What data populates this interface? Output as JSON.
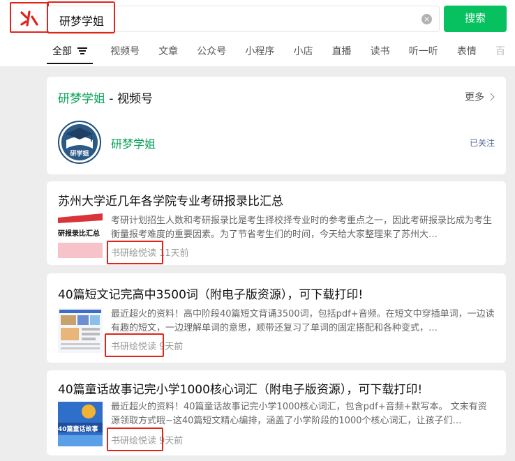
{
  "search": {
    "query": "研梦学姐",
    "button_label": "搜索",
    "clear_symbol": "×"
  },
  "tabs": [
    {
      "label": "全部"
    },
    {
      "label": "视频号"
    },
    {
      "label": "文章"
    },
    {
      "label": "公众号"
    },
    {
      "label": "小程序"
    },
    {
      "label": "小店"
    },
    {
      "label": "直播"
    },
    {
      "label": "读书"
    },
    {
      "label": "听一听"
    },
    {
      "label": "表情"
    },
    {
      "label": "百"
    }
  ],
  "channel_card": {
    "title_highlight": "研梦学姐",
    "title_suffix": " - 视频号",
    "more_label": "更多",
    "channel_name": "研梦学姐",
    "avatar_text": "研学姐",
    "follow_status": "已关注"
  },
  "articles": [
    {
      "title": "苏州大学近几年各学院专业考研报录比汇总",
      "thumb_text": "研报录比汇总",
      "desc": "考研计划招生人数和考研报录比是考生择校择专业时的参考重点之一，因此考研报录比成为考生衡量报考难度的重要因素。为了节省考生们的时间，今天给大家整理来了苏州大…",
      "source": "书研绘悦读",
      "time": "11天前"
    },
    {
      "title": "40篇短文记完高中3500词（附电子版资源），可下载打印!",
      "desc": "最近超火的资料！高中阶段40篇短文背诵3500词，包括pdf+音频。在短文中穿插单词，一边读有趣的短文，一边理解单词的意思，顺带还复习了单词的固定搭配和各种变式，…",
      "source": "书研绘悦读",
      "time": "9天前"
    },
    {
      "title": "40篇童话故事记完小学1000核心词汇（附电子版资源），可下载打印!",
      "thumb_text": "40篇童话故事",
      "desc": "最近超火的资料！40篇童话故事记完小学1000核心词汇，包含pdf+音频+默写本。 文末有资源领取方式哦~这40篇短文精心编排，涵盖了小学阶段的1000个核心词汇，让孩子们…",
      "source": "书研绘悦读",
      "time": "9天前"
    }
  ],
  "colors": {
    "brand_green": "#07c160",
    "highlight_red": "#e2231a",
    "link_blue": "#576b95"
  }
}
